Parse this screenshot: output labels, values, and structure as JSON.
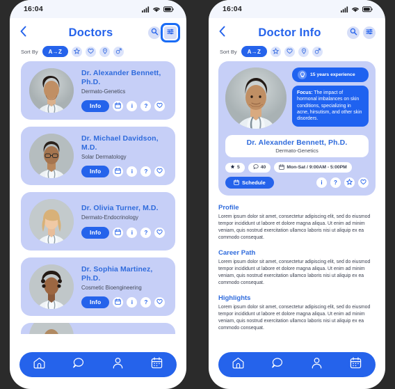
{
  "theme": {
    "accent": "#2563eb",
    "accent_alt": "#1f62f0",
    "card_bg": "#c6cff7",
    "name_color": "#2f6bdc",
    "page_bg": "#2b2b2b",
    "phone_bg": "#ffffff",
    "statusbar_bg": "#f3f6fd"
  },
  "status_bar": {
    "time": "16:04",
    "icons": [
      "signal-icon",
      "wifi-icon",
      "battery-icon"
    ]
  },
  "left_screen": {
    "header": {
      "back_icon": "chevron-left-icon",
      "title": "Doctors",
      "actions": [
        {
          "name": "search-icon",
          "selected": false
        },
        {
          "name": "filter-icon",
          "selected": true
        }
      ]
    },
    "sort": {
      "label": "Sort By",
      "active_pill": "A→Z",
      "icons": [
        "star-icon",
        "heart-icon",
        "location-pin-icon",
        "gender-male-icon"
      ]
    },
    "card_action_icons": [
      "calendar-icon",
      "info-icon",
      "question-icon",
      "heart-icon"
    ],
    "info_label": "Info",
    "doctors": [
      {
        "name": "Dr. Alexander Bennett, Ph.D.",
        "specialty": "Dermato-Genetics",
        "avatar": "male-doctor-dark-hair"
      },
      {
        "name": "Dr. Michael Davidson, M.D.",
        "specialty": "Solar Dermatology",
        "avatar": "male-doctor-glasses"
      },
      {
        "name": "Dr. Olivia Turner, M.D.",
        "specialty": "Dermato-Endocrinology",
        "avatar": "female-doctor-blonde"
      },
      {
        "name": "Dr. Sophia Martinez, Ph.D.",
        "specialty": "Cosmetic Bioengineering",
        "avatar": "female-doctor-curly"
      },
      {
        "name": "",
        "specialty": "",
        "avatar": "partial-card"
      }
    ]
  },
  "right_screen": {
    "header": {
      "back_icon": "chevron-left-icon",
      "title": "Doctor Info",
      "actions": [
        {
          "name": "search-icon",
          "selected": false
        },
        {
          "name": "filter-icon",
          "selected": false
        }
      ]
    },
    "sort": {
      "label": "Sort By",
      "active_pill": "A→Z",
      "icons": [
        "star-icon",
        "heart-icon",
        "location-pin-icon",
        "gender-male-icon"
      ]
    },
    "profile": {
      "avatar": "male-doctor-dark-hair",
      "experience_badge": "15 years experience",
      "experience_icon": "lightbulb-icon",
      "focus_label": "Focus:",
      "focus_text": " The impact of hormonal imbalances on skin conditions, specializing in acne, hirsutism, and other skin disorders.",
      "name": "Dr. Alexander Bennett, Ph.D.",
      "specialty": "Dermato-Genetics",
      "rating": "5",
      "rating_icon": "star-icon",
      "reviews": "40",
      "reviews_icon": "comment-icon",
      "hours": "Mon-Sat / 9:00AM - 5:00PM",
      "hours_icon": "calendar-icon",
      "schedule_label": "Schedule",
      "schedule_icon": "calendar-icon",
      "action_icons": [
        "info-icon",
        "question-icon",
        "star-icon",
        "heart-icon"
      ]
    },
    "sections": [
      {
        "title": "Profile",
        "body": "Lorem ipsum dolor sit amet, consectetur adipiscing elit, sed do eiusmod tempor incididunt ut labore et dolore magna aliqua. Ut enim ad minim veniam, quis nostrud exercitation ullamco laboris nisi ut aliquip ex ea commodo consequat."
      },
      {
        "title": "Career Path",
        "body": "Lorem ipsum dolor sit amet, consectetur adipiscing elit, sed do eiusmod tempor incididunt ut labore et dolore magna aliqua. Ut enim ad minim veniam, quis nostrud exercitation ullamco laboris nisi ut aliquip ex ea commodo consequat."
      },
      {
        "title": "Highlights",
        "body": "Lorem ipsum dolor sit amet, consectetur adipiscing elit, sed do eiusmod tempor incididunt ut labore et dolore magna aliqua. Ut enim ad minim veniam, quis nostrud exercitation ullamco laboris nisi ut aliquip ex ea commodo consequat."
      }
    ]
  },
  "bottom_nav": {
    "items": [
      "home-icon",
      "chat-icon",
      "profile-icon",
      "calendar-icon"
    ]
  }
}
